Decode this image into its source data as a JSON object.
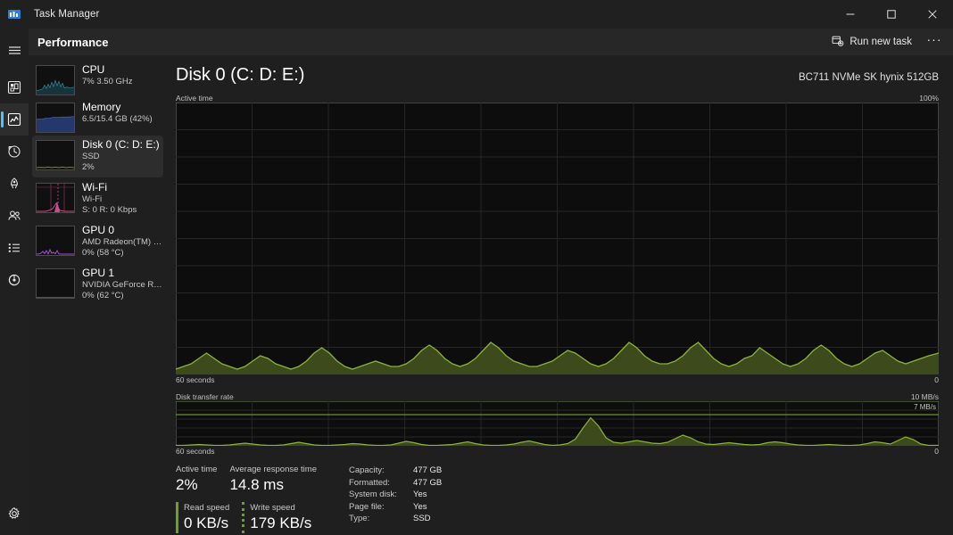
{
  "window": {
    "title": "Task Manager",
    "app_icon": "task-manager-icon",
    "minimize": "minimize",
    "maximize": "maximize",
    "close": "close"
  },
  "rail": {
    "items": [
      {
        "name": "hamburger-menu",
        "icon": "hamburger-icon",
        "active": false
      },
      {
        "name": "processes",
        "icon": "processes-icon",
        "active": false
      },
      {
        "name": "performance",
        "icon": "performance-icon",
        "active": true
      },
      {
        "name": "app-history",
        "icon": "history-clock-icon",
        "active": false
      },
      {
        "name": "startup-apps",
        "icon": "rocket-icon",
        "active": false
      },
      {
        "name": "users",
        "icon": "users-icon",
        "active": false
      },
      {
        "name": "details",
        "icon": "list-icon",
        "active": false
      },
      {
        "name": "services",
        "icon": "services-gear-icon",
        "active": false
      }
    ],
    "settings": {
      "name": "settings",
      "icon": "gear-icon"
    }
  },
  "header": {
    "title": "Performance",
    "run_new_task": "Run new task",
    "run_new_task_icon": "run-task-icon",
    "more_options": "···"
  },
  "sidebar": {
    "items": [
      {
        "name": "CPU",
        "sub1": "7%  3.50 GHz",
        "sub2": "",
        "selected": false,
        "color": "#3aa0b0"
      },
      {
        "name": "Memory",
        "sub1": "6.5/15.4 GB (42%)",
        "sub2": "",
        "selected": false,
        "color": "#3c5b9b"
      },
      {
        "name": "Disk 0 (C: D: E:)",
        "sub1": "SSD",
        "sub2": "2%",
        "selected": true,
        "color": "#7aa73a"
      },
      {
        "name": "Wi-Fi",
        "sub1": "Wi-Fi",
        "sub2": "S: 0 R: 0 Kbps",
        "selected": false,
        "color": "#c44f8e"
      },
      {
        "name": "GPU 0",
        "sub1": "AMD Radeon(TM) Gr...",
        "sub2": "0%  (58 °C)",
        "selected": false,
        "color": "#a350d0"
      },
      {
        "name": "GPU 1",
        "sub1": "NVIDIA GeForce RTX...",
        "sub2": "0%  (62 °C)",
        "selected": false,
        "color": "#a350d0"
      }
    ]
  },
  "main": {
    "title": "Disk 0 (C: D: E:)",
    "device": "BC711 NVMe SK hynix 512GB",
    "graph1": {
      "label": "Active time",
      "max_label": "100%",
      "x_left": "60 seconds",
      "x_right": "0"
    },
    "graph2": {
      "label": "Disk transfer rate",
      "max_label": "10 MB/s",
      "marker_label": "7 MB/s",
      "x_left": "60 seconds",
      "x_right": "0"
    },
    "stats": {
      "active_time_label": "Active time",
      "active_time_value": "2%",
      "avg_response_label": "Average response time",
      "avg_response_value": "14.8 ms",
      "read_speed_label": "Read speed",
      "read_speed_value": "0 KB/s",
      "write_speed_label": "Write speed",
      "write_speed_value": "179 KB/s",
      "details": [
        {
          "key": "Capacity:",
          "value": "477 GB"
        },
        {
          "key": "Formatted:",
          "value": "477 GB"
        },
        {
          "key": "System disk:",
          "value": "Yes"
        },
        {
          "key": "Page file:",
          "value": "Yes"
        },
        {
          "key": "Type:",
          "value": "SSD"
        }
      ]
    }
  },
  "colors": {
    "accent": "#4cc2ff",
    "disk_line": "#8ab33a",
    "disk_fill": "#3c4a1c",
    "graph_bg": "#0d0d0d",
    "grid": "#2a2a2a"
  },
  "chart_data": {
    "type": "area",
    "charts": [
      {
        "title": "Active time",
        "ylim": [
          0,
          100
        ],
        "ylabel": "%",
        "xlabel": "60 seconds",
        "values": [
          2,
          3,
          4,
          6,
          8,
          6,
          4,
          3,
          2,
          3,
          5,
          7,
          6,
          4,
          3,
          2,
          3,
          5,
          8,
          10,
          8,
          5,
          3,
          2,
          3,
          4,
          5,
          4,
          3,
          3,
          4,
          6,
          9,
          11,
          9,
          6,
          4,
          3,
          4,
          6,
          9,
          12,
          10,
          7,
          5,
          4,
          3,
          3,
          4,
          5,
          7,
          9,
          8,
          6,
          4,
          3,
          4,
          6,
          9,
          12,
          10,
          7,
          5,
          4,
          4,
          5,
          7,
          10,
          12,
          9,
          6,
          4,
          3,
          4,
          6,
          8,
          10,
          8,
          6,
          4,
          3,
          4,
          6,
          9,
          11,
          9,
          6,
          4,
          3,
          4,
          6,
          8,
          9,
          7,
          5,
          4,
          4,
          5,
          6,
          7
        ]
      },
      {
        "title": "Disk transfer rate",
        "ylim": [
          0,
          10
        ],
        "ylabel": "MB/s",
        "xlabel": "60 seconds",
        "marker": 7,
        "values": [
          0.1,
          0.1,
          0.2,
          0.3,
          0.2,
          0.1,
          0.1,
          0.2,
          0.4,
          0.6,
          0.4,
          0.2,
          0.1,
          0.1,
          0.2,
          0.5,
          0.8,
          0.5,
          0.2,
          0.1,
          0.1,
          0.2,
          0.3,
          0.5,
          0.4,
          0.2,
          0.1,
          0.1,
          0.2,
          0.6,
          1.0,
          0.7,
          0.3,
          0.1,
          0.1,
          0.2,
          0.3,
          0.6,
          0.9,
          0.5,
          0.2,
          0.1,
          0.1,
          0.2,
          0.4,
          0.8,
          1.1,
          0.7,
          0.3,
          0.1,
          0.2,
          0.5,
          1.5,
          4.0,
          6.3,
          4.5,
          1.8,
          0.8,
          0.6,
          0.9,
          1.2,
          0.9,
          0.6,
          0.5,
          0.8,
          1.6,
          2.4,
          1.8,
          0.9,
          0.4,
          0.3,
          0.5,
          0.7,
          0.5,
          0.3,
          0.2,
          0.3,
          0.6,
          1.0,
          1.2,
          0.9,
          0.5,
          0.3,
          0.2,
          0.2,
          0.3,
          0.4,
          0.3,
          0.2,
          0.2,
          0.3,
          0.6,
          1.0,
          0.8,
          0.5,
          1.2,
          2.6,
          3.4,
          2.2,
          0.6
        ]
      }
    ]
  }
}
